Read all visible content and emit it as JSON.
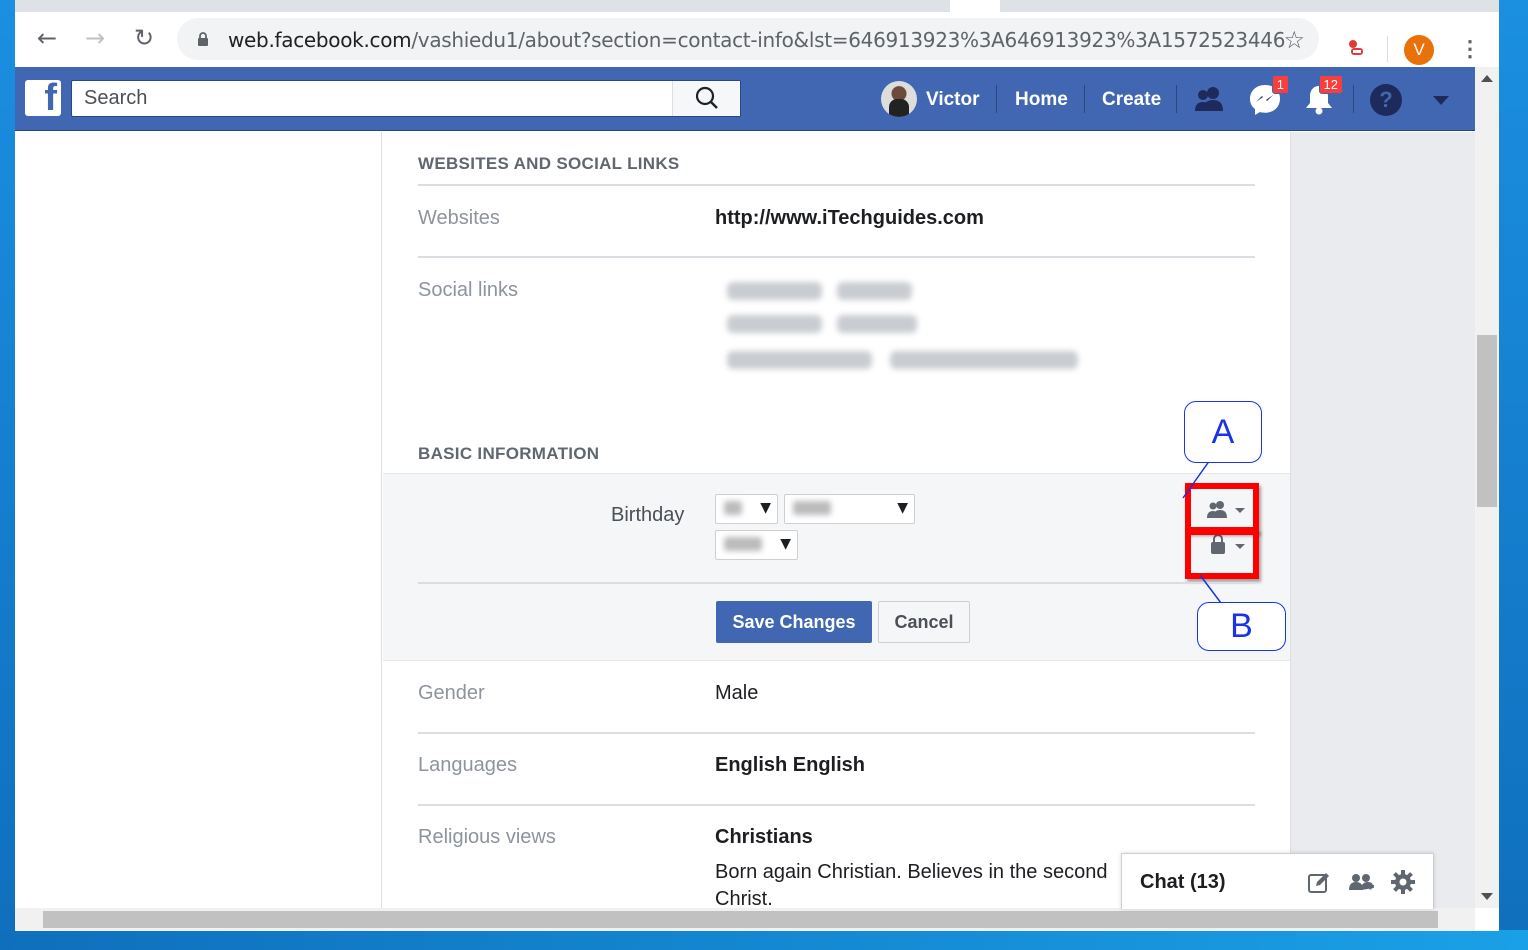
{
  "browser": {
    "url_host": "web.facebook.com",
    "url_rest": "/vashiedu1/about?section=contact-info&lst=646913923%3A646913923%3A1572523446",
    "profile_initial": "V",
    "icons": [
      "back-icon",
      "forward-icon",
      "reload-icon",
      "lock-icon",
      "star-icon",
      "extension-icon",
      "menu-icon"
    ]
  },
  "fb_nav": {
    "search_placeholder": "Search",
    "profile_name": "Victor",
    "home": "Home",
    "create": "Create",
    "messenger_badge": "1",
    "notifications_badge": "12",
    "help": "?"
  },
  "websites_section": {
    "title": "WEBSITES AND SOCIAL LINKS",
    "websites_label": "Websites",
    "websites_value": "http://www.iTechguides.com",
    "social_label": "Social links"
  },
  "basic_info": {
    "title": "BASIC INFORMATION",
    "birthday_label": "Birthday",
    "save_button": "Save Changes",
    "cancel_button": "Cancel",
    "gender_label": "Gender",
    "gender_value": "Male",
    "languages_label": "Languages",
    "languages_value": "English English",
    "religious_label": "Religious views",
    "religious_value": "Christians",
    "religious_desc_line1": "Born again Christian. Believes in the second",
    "religious_desc_line2": "Christ."
  },
  "annotations": {
    "callout_a": "A",
    "callout_b": "B",
    "highlight_color": "#ff0000",
    "callout_color": "#1a32e8"
  },
  "chat": {
    "title": "Chat (13)"
  },
  "colors": {
    "facebook_blue": "#4267b2",
    "badge_red": "#fa3e3e"
  }
}
